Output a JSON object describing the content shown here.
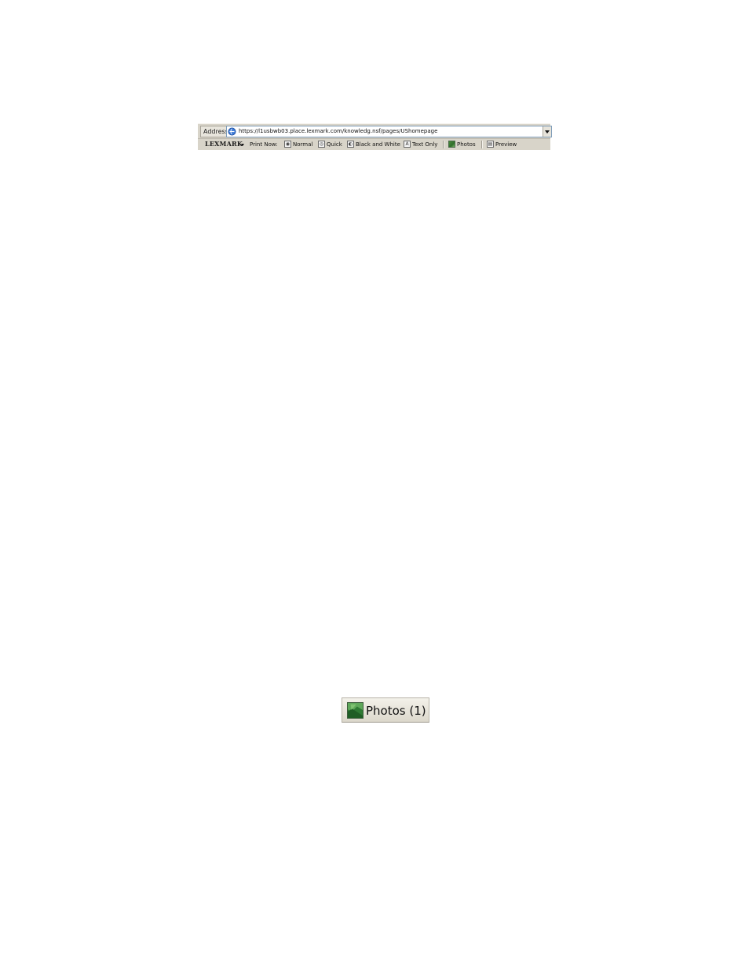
{
  "address_bar": {
    "label": "Address",
    "url": "https://l1usbwb03.place.lexmark.com/knowledg.nsf/pages/UShomepage"
  },
  "lexmark_toolbar": {
    "brand": "LEXMARK",
    "print_now_label": "Print Now:",
    "buttons": [
      {
        "label": "Normal",
        "icon": "normal-print-icon"
      },
      {
        "label": "Quick",
        "icon": "quick-print-icon"
      },
      {
        "label": "Black and White",
        "icon": "black-white-print-icon"
      },
      {
        "label": "Text Only",
        "icon": "text-only-print-icon"
      },
      {
        "label": "Photos",
        "icon": "photo-icon"
      },
      {
        "label": "Preview",
        "icon": "preview-icon"
      }
    ]
  },
  "photos_button": {
    "label": "Photos (1)",
    "icon": "photo-icon"
  },
  "colors": {
    "toolbar_bg": "#d8d4c9",
    "photo_icon_green": "#2f7f34",
    "address_border": "#7f9db9"
  }
}
